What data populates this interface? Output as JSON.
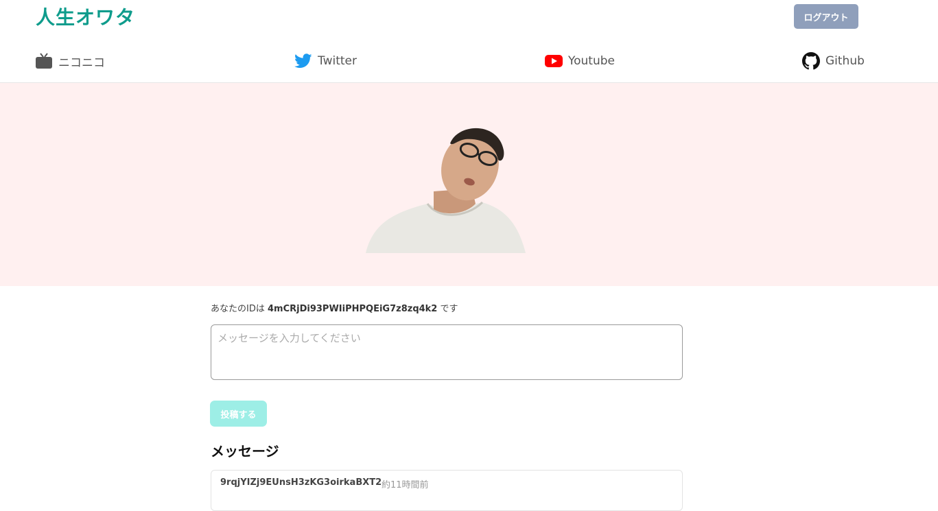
{
  "header": {
    "logo": "人生オワタ",
    "logout_label": "ログアウト"
  },
  "nav": {
    "items": [
      {
        "label": "ニコニコ",
        "icon": "tv-icon"
      },
      {
        "label": "Twitter",
        "icon": "twitter-icon",
        "color": "#1d9bf0"
      },
      {
        "label": "Youtube",
        "icon": "youtube-icon",
        "color": "#ff0000"
      },
      {
        "label": "Github",
        "icon": "github-icon"
      }
    ]
  },
  "hero": {
    "background": "#fff0f0"
  },
  "form": {
    "id_prefix": "あなたのIDは",
    "user_id": "4mCRjDi93PWIiPHPQEiG7z8zq4k2",
    "id_suffix": "です",
    "placeholder": "メッセージを入力してください",
    "submit_label": "投稿する"
  },
  "messages": {
    "title": "メッセージ",
    "items": [
      {
        "author": "9rqjYIZj9EUnsH3zKG3oirkaBXT2",
        "time": "約11時間前"
      }
    ]
  }
}
